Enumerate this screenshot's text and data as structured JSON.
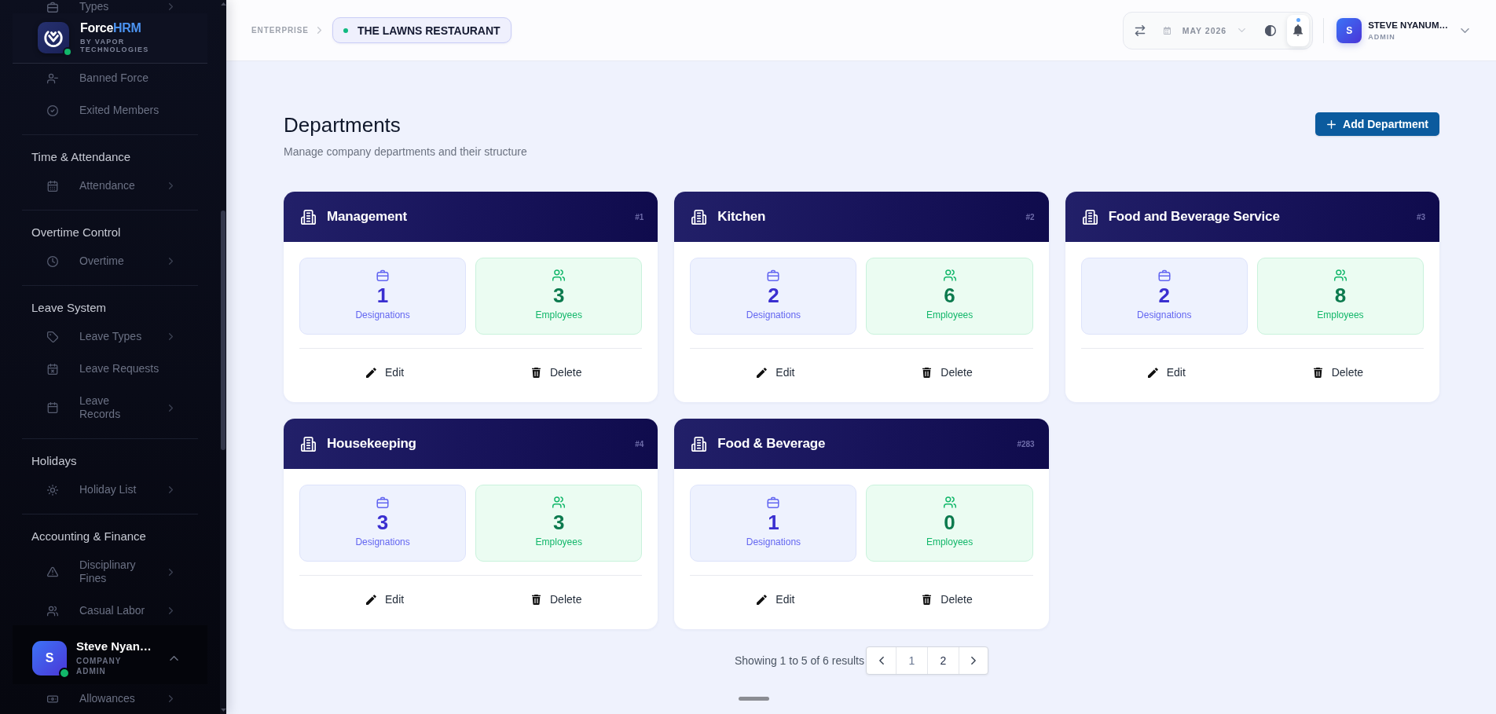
{
  "sidebar": {
    "top_item": {
      "label": "Types",
      "submenu": true
    },
    "brand": {
      "name": "Force",
      "name_accent": "HRM",
      "tagline": "BY VAPOR TECHNOLOGIES",
      "online": true
    },
    "sections": [
      {
        "items": [
          {
            "label": "Banned Force",
            "submenu": false
          },
          {
            "label": "Exited Members",
            "submenu": false
          }
        ]
      },
      {
        "title": "Time & Attendance",
        "items": [
          {
            "label": "Attendance",
            "submenu": true
          }
        ]
      },
      {
        "title": "Overtime Control",
        "items": [
          {
            "label": "Overtime",
            "submenu": true
          }
        ]
      },
      {
        "title": "Leave System",
        "items": [
          {
            "label": "Leave Types",
            "submenu": true
          },
          {
            "label": "Leave Requests",
            "submenu": false
          },
          {
            "label": "Leave Records",
            "submenu": true
          }
        ]
      },
      {
        "title": "Holidays",
        "items": [
          {
            "label": "Holiday List",
            "submenu": true
          }
        ]
      },
      {
        "title": "Accounting & Finance",
        "items": [
          {
            "label": "Disciplinary Fines",
            "submenu": true
          },
          {
            "label": "Casual Labor",
            "submenu": true
          }
        ]
      }
    ],
    "user": {
      "initial": "S",
      "name": "Steve Nyan…",
      "role": "COMPANY ADMIN",
      "online": true
    },
    "bottom_item": {
      "label": "Allowances",
      "submenu": true
    }
  },
  "topbar": {
    "breadcrumb": "ENTERPRISE",
    "workspace": {
      "name": "THE LAWNS RESTAURANT",
      "active": true
    },
    "period": "MAY 2026",
    "notifications": {
      "unread": true
    },
    "user": {
      "initial": "S",
      "name": "STEVE NYANUM…",
      "role": "ADMIN"
    }
  },
  "page": {
    "title": "Departments",
    "subtitle": "Manage company departments and their structure",
    "add_button": "Add Department"
  },
  "departments": [
    {
      "name": "Management",
      "code": "#1",
      "stats": [
        {
          "kind": "designations",
          "value": "1",
          "label": "Designations"
        },
        {
          "kind": "employees",
          "value": "3",
          "label": "Employees"
        }
      ],
      "actions": [
        {
          "kind": "edit",
          "label": "Edit"
        },
        {
          "kind": "delete",
          "label": "Delete"
        }
      ]
    },
    {
      "name": "Kitchen",
      "code": "#2",
      "stats": [
        {
          "kind": "designations",
          "value": "2",
          "label": "Designations"
        },
        {
          "kind": "employees",
          "value": "6",
          "label": "Employees"
        }
      ],
      "actions": [
        {
          "kind": "edit",
          "label": "Edit"
        },
        {
          "kind": "delete",
          "label": "Delete"
        }
      ]
    },
    {
      "name": "Food and Beverage Service",
      "code": "#3",
      "stats": [
        {
          "kind": "designations",
          "value": "2",
          "label": "Designations"
        },
        {
          "kind": "employees",
          "value": "8",
          "label": "Employees"
        }
      ],
      "actions": [
        {
          "kind": "edit",
          "label": "Edit"
        },
        {
          "kind": "delete",
          "label": "Delete"
        }
      ]
    },
    {
      "name": "Housekeeping",
      "code": "#4",
      "stats": [
        {
          "kind": "designations",
          "value": "3",
          "label": "Designations"
        },
        {
          "kind": "employees",
          "value": "3",
          "label": "Employees"
        }
      ],
      "actions": [
        {
          "kind": "edit",
          "label": "Edit"
        },
        {
          "kind": "delete",
          "label": "Delete"
        }
      ]
    },
    {
      "name": "Food & Beverage",
      "code": "#283",
      "stats": [
        {
          "kind": "designations",
          "value": "1",
          "label": "Designations"
        },
        {
          "kind": "employees",
          "value": "0",
          "label": "Employees"
        }
      ],
      "actions": [
        {
          "kind": "edit",
          "label": "Edit"
        },
        {
          "kind": "delete",
          "label": "Delete"
        }
      ]
    }
  ],
  "pagination": {
    "summary": "Showing 1 to 5 of 6 results",
    "pages": [
      {
        "label": "1",
        "selected": true
      },
      {
        "label": "2",
        "selected": false
      }
    ]
  }
}
